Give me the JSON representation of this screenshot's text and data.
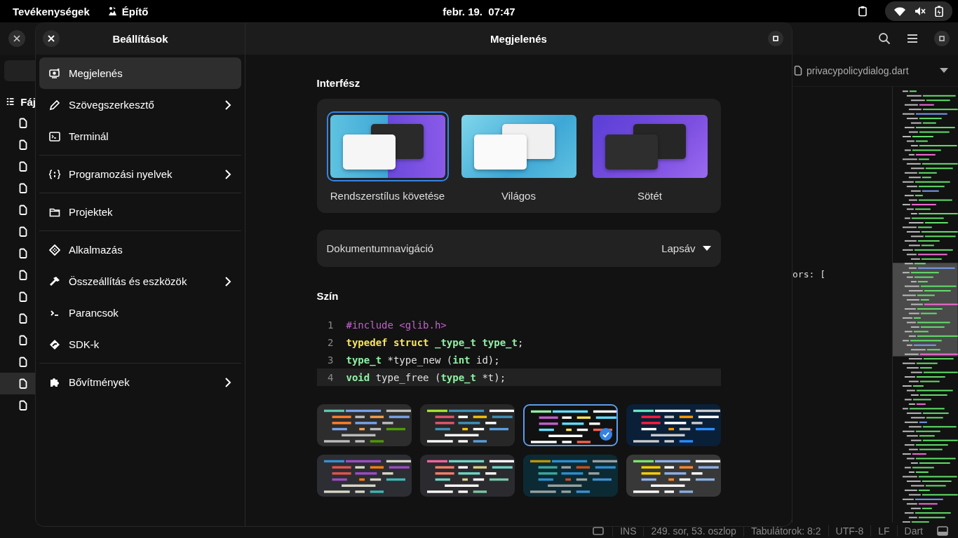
{
  "top_bar": {
    "activities": "Tevékenységek",
    "app_name": "Építő",
    "clock": "febr. 19.  07:47"
  },
  "background_window": {
    "files_header": "Fáj",
    "files": [
      {
        "selected": false
      },
      {
        "selected": false
      },
      {
        "selected": false
      },
      {
        "selected": false
      },
      {
        "selected": false
      },
      {
        "selected": false
      },
      {
        "selected": false
      },
      {
        "selected": false
      },
      {
        "selected": false
      },
      {
        "selected": false
      },
      {
        "selected": false
      },
      {
        "selected": false
      },
      {
        "selected": true
      },
      {
        "selected": false
      }
    ],
    "tab": {
      "title": "privacypolicydialog.dart"
    },
    "code_fragment": "ors: [",
    "status_bar": [
      "INS",
      "249. sor, 53. oszlop",
      "Tabulátorok: 8:2",
      "UTF-8",
      "LF",
      "Dart"
    ]
  },
  "dialog": {
    "sidebar_title": "Beállítások",
    "title": "Megjelenés",
    "sidebar_groups": [
      [
        {
          "label": "Megjelenés",
          "kind": "appearance",
          "submenu": false,
          "selected": true
        },
        {
          "label": "Szövegszerkesztő",
          "kind": "pencil",
          "submenu": true,
          "selected": false
        },
        {
          "label": "Terminál",
          "kind": "terminal",
          "submenu": false,
          "selected": false
        }
      ],
      [
        {
          "label": "Programozási nyelvek",
          "kind": "code",
          "submenu": true,
          "selected": false
        }
      ],
      [
        {
          "label": "Projektek",
          "kind": "folder",
          "submenu": false,
          "selected": false
        }
      ],
      [
        {
          "label": "Alkalmazás",
          "kind": "app",
          "submenu": false,
          "selected": false
        },
        {
          "label": "Összeállítás és eszközök",
          "kind": "hammer",
          "submenu": true,
          "selected": false
        },
        {
          "label": "Parancsok",
          "kind": "prompt",
          "submenu": false,
          "selected": false
        },
        {
          "label": "SDK-k",
          "kind": "sdk",
          "submenu": false,
          "selected": false
        }
      ],
      [
        {
          "label": "Bővítmények",
          "kind": "puzzle",
          "submenu": true,
          "selected": false
        }
      ]
    ],
    "interface": {
      "heading": "Interfész",
      "styles": [
        {
          "label": "Rendszerstílus követése",
          "kind": "system",
          "selected": true
        },
        {
          "label": "Világos",
          "kind": "light",
          "selected": false
        },
        {
          "label": "Sötét",
          "kind": "dark",
          "selected": false
        }
      ],
      "navigation": {
        "label": "Dokumentumnavigáció",
        "value": "Lapsáv"
      }
    },
    "color": {
      "heading": "Szín",
      "preview_lines": [
        {
          "number": "1",
          "current": false,
          "tokens": [
            {
              "text": "#include <glib.h>",
              "kind": "preproc"
            }
          ]
        },
        {
          "number": "2",
          "current": false,
          "tokens": [
            {
              "text": "typedef",
              "kind": "keyword"
            },
            {
              "text": " struct",
              "kind": "keyword"
            },
            {
              "text": " _type_t type_t",
              "kind": "type"
            },
            {
              "text": ";",
              "kind": "plain"
            }
          ]
        },
        {
          "number": "3",
          "current": false,
          "tokens": [
            {
              "text": "type_t",
              "kind": "type"
            },
            {
              "text": " *type_new (",
              "kind": "plain"
            },
            {
              "text": "int",
              "kind": "type"
            },
            {
              "text": " id);",
              "kind": "plain"
            }
          ]
        },
        {
          "number": "4",
          "current": true,
          "tokens": [
            {
              "text": "void",
              "kind": "type"
            },
            {
              "text": " type_free (",
              "kind": "plain"
            },
            {
              "text": "type_t",
              "kind": "type"
            },
            {
              "text": " *t);",
              "kind": "plain"
            }
          ]
        }
      ],
      "schemes": [
        {
          "color": "#2d2d2d",
          "selected": false
        },
        {
          "color": "#272727",
          "selected": false
        },
        {
          "color": "#111111",
          "selected": true
        },
        {
          "color": "#0a1f38",
          "selected": false
        },
        {
          "color": "#2c2e33",
          "selected": false
        },
        {
          "color": "#2a2a2f",
          "selected": false
        },
        {
          "color": "#0c2a33",
          "selected": false
        },
        {
          "color": "#383838",
          "selected": false
        }
      ]
    }
  }
}
